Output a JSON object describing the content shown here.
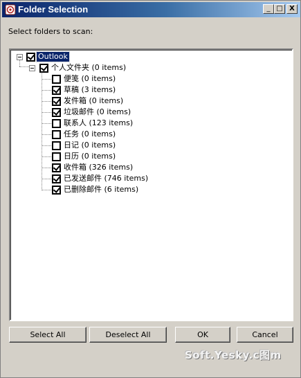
{
  "window": {
    "title": "Folder Selection"
  },
  "titlebar_buttons": {
    "minimize": "_",
    "maximize": "□",
    "close": "X"
  },
  "instruction": "Select folders to scan:",
  "tree": {
    "root": {
      "label": "Outlook",
      "checked": true,
      "selected": true
    },
    "store": {
      "label": "个人文件夹 (0 items)",
      "checked": true
    },
    "folders": [
      {
        "label": "便笺 (0 items)",
        "checked": false
      },
      {
        "label": "草稿 (3 items)",
        "checked": true
      },
      {
        "label": "发件箱 (0 items)",
        "checked": true
      },
      {
        "label": "垃圾邮件 (0 items)",
        "checked": true
      },
      {
        "label": "联系人 (123 items)",
        "checked": false
      },
      {
        "label": "任务 (0 items)",
        "checked": false
      },
      {
        "label": "日记 (0 items)",
        "checked": false
      },
      {
        "label": "日历 (0 items)",
        "checked": false
      },
      {
        "label": "收件箱 (326 items)",
        "checked": true
      },
      {
        "label": "已发送邮件 (746 items)",
        "checked": true
      },
      {
        "label": "已删除邮件 (6 items)",
        "checked": true
      }
    ]
  },
  "buttons": {
    "select_all": "Select All",
    "deselect_all": "Deselect All",
    "ok": "OK",
    "cancel": "Cancel"
  },
  "watermark": "Soft.Yesky.c图m"
}
